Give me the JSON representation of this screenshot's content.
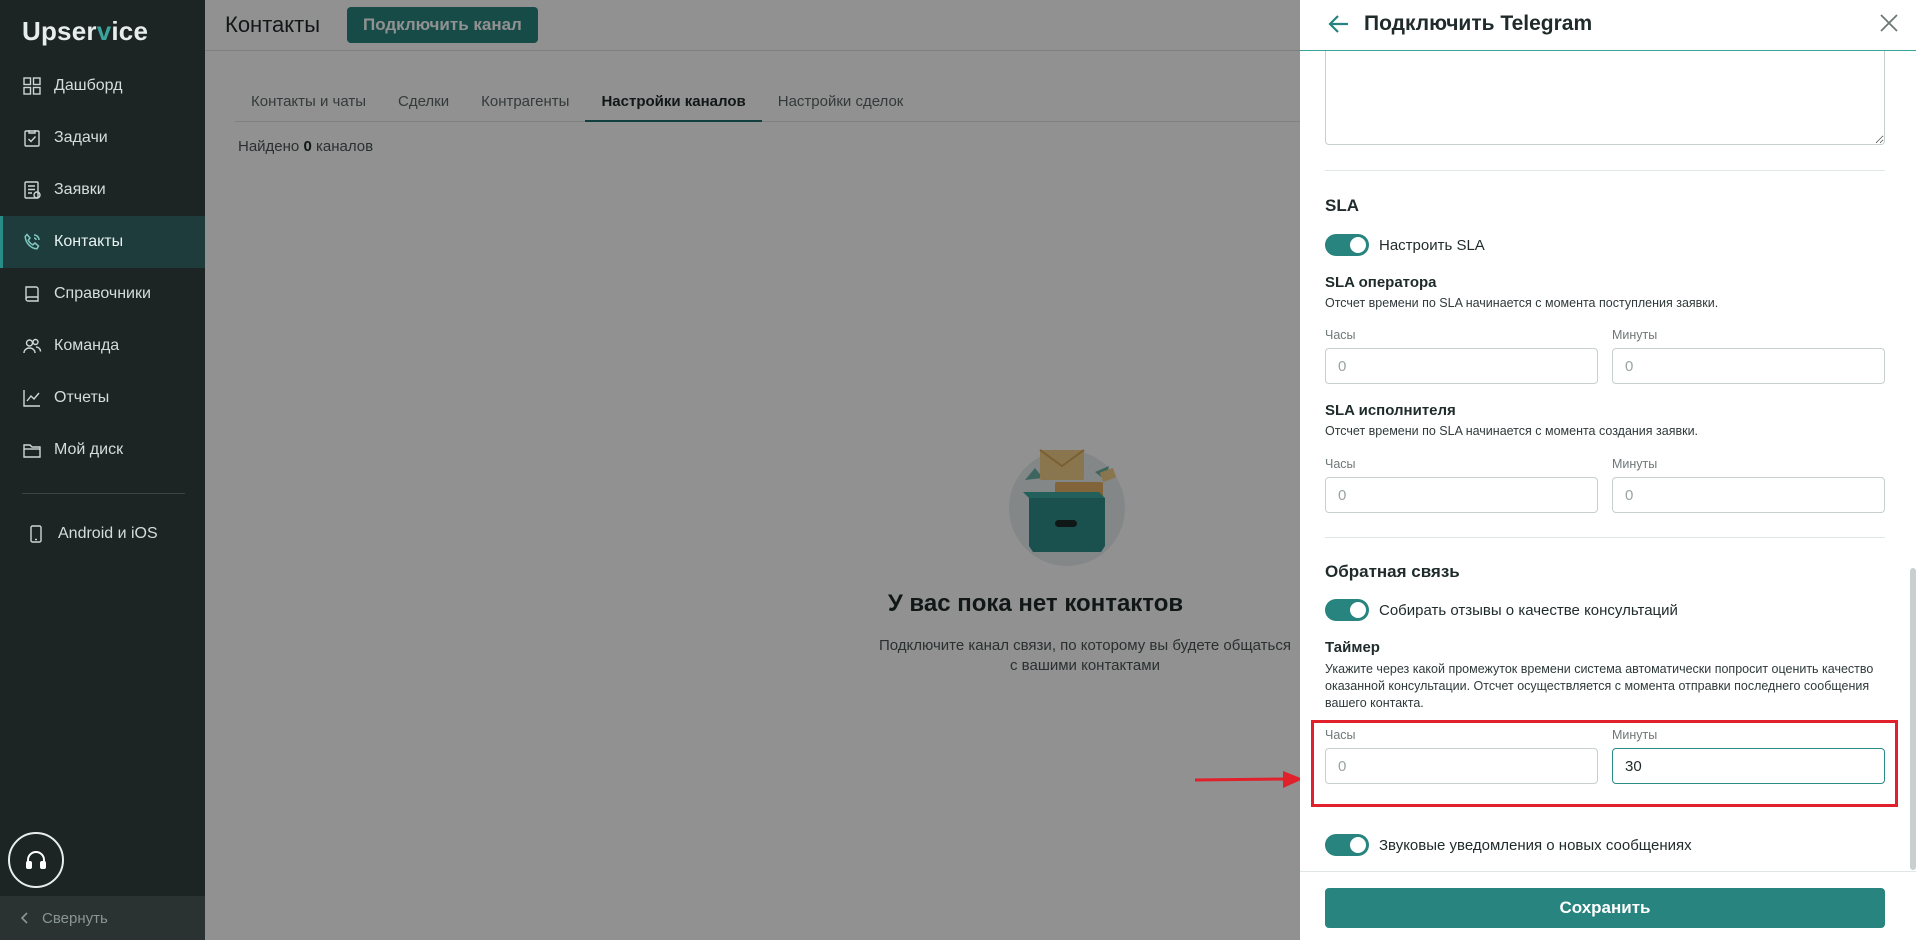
{
  "app": {
    "logo_pre": "Upser",
    "logo_v": "v",
    "logo_post": "ice"
  },
  "sidebar": {
    "items": [
      {
        "label": "Дашборд",
        "icon": "dashboard-icon"
      },
      {
        "label": "Задачи",
        "icon": "tasks-icon"
      },
      {
        "label": "Заявки",
        "icon": "requests-icon"
      },
      {
        "label": "Контакты",
        "icon": "contacts-icon",
        "active": true
      },
      {
        "label": "Справочники",
        "icon": "book-icon"
      },
      {
        "label": "Команда",
        "icon": "team-icon"
      },
      {
        "label": "Отчеты",
        "icon": "chart-icon"
      },
      {
        "label": "Мой диск",
        "icon": "folder-icon"
      }
    ],
    "mobile_label": "Android и iOS",
    "collapse_label": "Свернуть"
  },
  "header": {
    "title": "Контакты",
    "connect_label": "Подключить канал"
  },
  "tabs": [
    "Контакты и чаты",
    "Сделки",
    "Контрагенты",
    "Настройки каналов",
    "Настройки сделок"
  ],
  "active_tab": 3,
  "found": {
    "prefix": "Найдено",
    "count": "0",
    "suffix": "каналов"
  },
  "empty": {
    "title": "У вас пока нет контактов",
    "subtitle_line1": "Подключите канал связи, по которому вы будете общаться",
    "subtitle_line2": "с вашими контактами"
  },
  "drawer": {
    "title": "Подключить Telegram",
    "sla": {
      "title": "SLA",
      "toggle_label": "Настроить SLA",
      "operator": {
        "title": "SLA оператора",
        "desc": "Отсчет времени по SLA начинается с момента поступления заявки.",
        "hours_label": "Часы",
        "hours_placeholder": "0",
        "minutes_label": "Минуты",
        "minutes_placeholder": "0"
      },
      "executor": {
        "title": "SLA исполнителя",
        "desc": "Отсчет времени по SLA начинается с момента создания заявки.",
        "hours_label": "Часы",
        "hours_placeholder": "0",
        "minutes_label": "Минуты",
        "minutes_placeholder": "0"
      }
    },
    "feedback": {
      "title": "Обратная связь",
      "toggle_label": "Собирать отзывы о качестве консультаций",
      "timer_title": "Таймер",
      "timer_desc": "Укажите через какой промежуток времени система автоматически попросит оценить качество оказанной консультации. Отсчет осуществляется с момента отправки последнего сообщения вашего контакта.",
      "hours_label": "Часы",
      "hours_placeholder": "0",
      "minutes_label": "Минуты",
      "minutes_value": "30"
    },
    "sound_toggle_label": "Звуковые уведомления о новых сообщениях",
    "save_label": "Сохранить"
  },
  "colors": {
    "accent": "#27847f",
    "sidebar_bg": "#1c2424",
    "highlight": "#e0202a"
  }
}
